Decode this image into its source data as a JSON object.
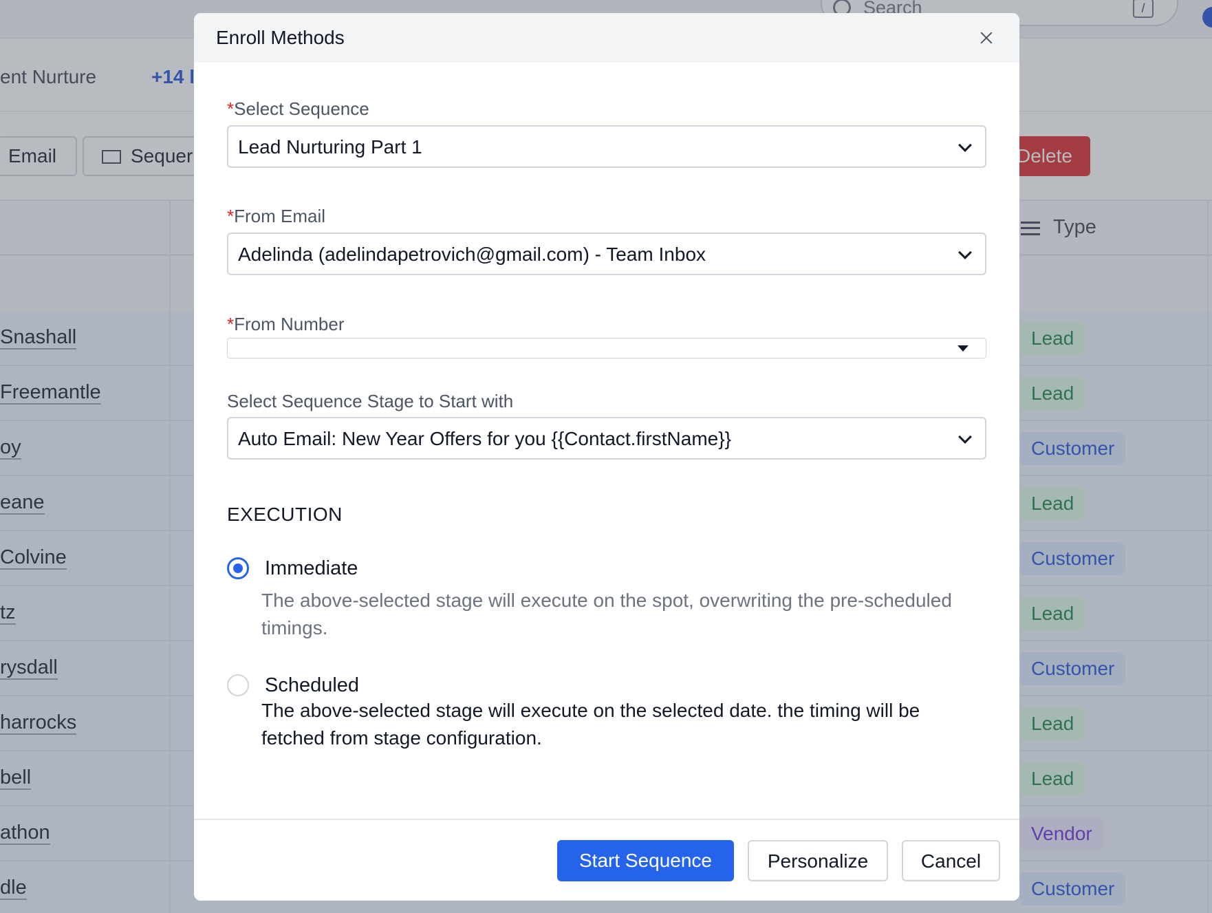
{
  "background": {
    "search_placeholder": "Search",
    "search_shortcut": "/",
    "filter_tab": "ent Nurture",
    "filter_more": "+14 l",
    "toolbar": {
      "email": "Email",
      "sequence": "Sequer",
      "delete": "Delete"
    },
    "table": {
      "type_header": "Type",
      "rows": [
        {
          "name": "Snashall",
          "type": "Lead"
        },
        {
          "name": "Freemantle",
          "type": "Lead"
        },
        {
          "name": "oy",
          "type": "Customer"
        },
        {
          "name": "eane",
          "type": "Lead"
        },
        {
          "name": "Colvine",
          "type": "Customer"
        },
        {
          "name": "tz",
          "type": "Lead"
        },
        {
          "name": "rysdall",
          "type": "Customer"
        },
        {
          "name": "harrocks",
          "type": "Lead"
        },
        {
          "name": "bell",
          "type": "Lead"
        },
        {
          "name": "athon",
          "type": "Vendor"
        },
        {
          "name": "dle",
          "type": "Customer"
        }
      ]
    }
  },
  "modal": {
    "title": "Enroll Methods",
    "select_sequence": {
      "label": "Select Sequence",
      "value": "Lead Nurturing Part 1"
    },
    "from_email": {
      "label": "From Email",
      "value": "Adelinda (adelindapetrovich@gmail.com) - Team Inbox"
    },
    "from_number": {
      "label": "From Number",
      "value": ""
    },
    "stage": {
      "label": "Select Sequence Stage to Start with",
      "value": "Auto Email: New Year Offers for you {{Contact.firstName}}"
    },
    "execution": {
      "title": "EXECUTION",
      "options": [
        {
          "label": "Immediate",
          "description": "The above-selected stage will execute on the spot, overwriting the pre-scheduled timings.",
          "selected": true
        },
        {
          "label": "Scheduled",
          "description": "The above-selected stage will execute on the selected date. the timing will be fetched from stage configuration.",
          "selected": false
        }
      ]
    },
    "buttons": {
      "start": "Start Sequence",
      "personalize": "Personalize",
      "cancel": "Cancel"
    }
  },
  "colors": {
    "primary": "#2563eb",
    "danger": "#dc2626",
    "required": "#dc2626",
    "lead_badge": "#15803d",
    "customer_badge": "#1d4ed8",
    "vendor_badge": "#6d28d9"
  }
}
